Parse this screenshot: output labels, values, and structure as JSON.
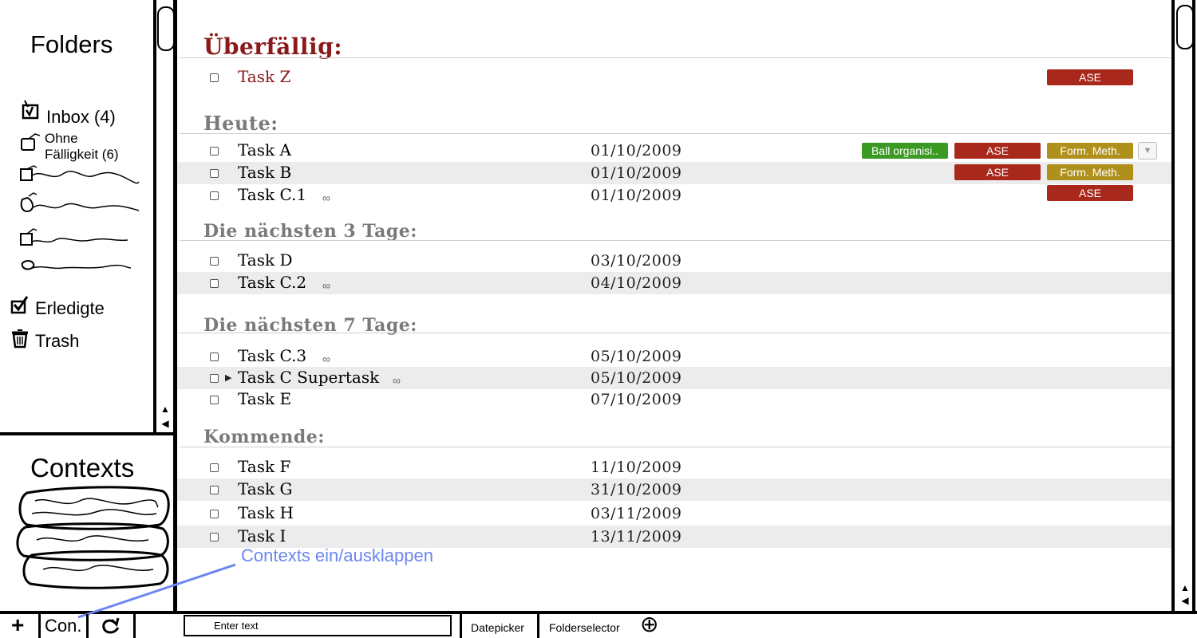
{
  "sidebar": {
    "folders_title": "Folders",
    "folders": [
      {
        "label": "Inbox (4)"
      },
      {
        "label": "Ohne Fälligkeit (6)",
        "line1": "Ohne",
        "line2": "Fälligkeit (6)"
      },
      {
        "label": "Erledigte"
      },
      {
        "label": "Trash"
      }
    ],
    "contexts_title": "Contexts"
  },
  "sections": [
    {
      "title": "Überfällig:"
    },
    {
      "title": "Heute:"
    },
    {
      "title": "Die nächsten 3 Tage:"
    },
    {
      "title": "Die nächsten 7 Tage:"
    },
    {
      "title": "Kommende:"
    }
  ],
  "tasks": [
    {
      "name": "Task Z",
      "date": "",
      "tags": [
        "ASE"
      ]
    },
    {
      "name": "Task A",
      "date": "01/10/2009",
      "tags": [
        "Ball organisi..",
        "ASE",
        "Form. Meth."
      ]
    },
    {
      "name": "Task B",
      "date": "01/10/2009",
      "tags": [
        "ASE",
        "Form. Meth."
      ]
    },
    {
      "name": "Task C.1",
      "date": "01/10/2009",
      "tags": [
        "ASE"
      ]
    },
    {
      "name": "Task D",
      "date": "03/10/2009",
      "tags": []
    },
    {
      "name": "Task C.2",
      "date": "04/10/2009",
      "tags": []
    },
    {
      "name": "Task C.3",
      "date": "05/10/2009",
      "tags": []
    },
    {
      "name": "Task C Supertask",
      "date": "05/10/2009",
      "tags": []
    },
    {
      "name": "Task E",
      "date": "07/10/2009",
      "tags": []
    },
    {
      "name": "Task F",
      "date": "11/10/2009",
      "tags": []
    },
    {
      "name": "Task G",
      "date": "31/10/2009",
      "tags": []
    },
    {
      "name": "Task H",
      "date": "03/11/2009",
      "tags": []
    },
    {
      "name": "Task I",
      "date": "13/11/2009",
      "tags": []
    }
  ],
  "annotation": "Contexts ein/ausklappen",
  "bottom_bar": {
    "add_label": "+",
    "contexts_short": "Con.",
    "input_placeholder": "Enter text",
    "datepicker_label": "Datepicker",
    "folderselector_label": "Folderselector",
    "add_circle_label": "⊕"
  },
  "colors": {
    "overdue_title": "#8a1a1a",
    "tag_green": "#3a9a22",
    "tag_red": "#a9281c",
    "tag_olive": "#b0901c",
    "annotation": "#6b86f0"
  },
  "icons": [
    "inbox-checkbox-icon",
    "folder-box-icon",
    "done-check-icon",
    "trash-icon",
    "link-icon",
    "expand-triangle-icon",
    "dropdown-arrow-icon",
    "refresh-icon",
    "add-circle-icon"
  ]
}
